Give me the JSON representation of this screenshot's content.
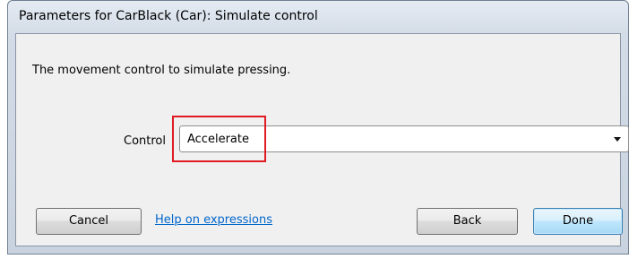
{
  "window": {
    "title": "Parameters for CarBlack (Car): Simulate control"
  },
  "dialog": {
    "description": "The movement control to simulate pressing.",
    "control_label": "Control",
    "control_value": "Accelerate"
  },
  "buttons": {
    "cancel": "Cancel",
    "help_link": "Help on expressions",
    "back": "Back",
    "done": "Done"
  },
  "colors": {
    "highlight": "#e01b24",
    "link": "#0066cc"
  }
}
